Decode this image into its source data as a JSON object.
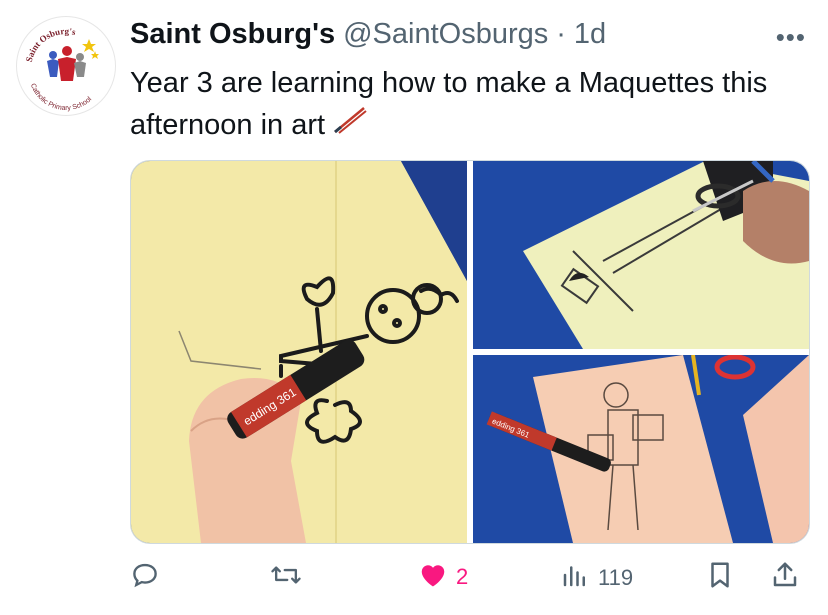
{
  "tweet": {
    "author_name": "Saint Osburg's",
    "handle": "@SaintOsburgs",
    "separator": "·",
    "time": "1d",
    "text": "Year 3 are learning how to make a Maquettes this afternoon in art",
    "emoji": "paintbrush-icon",
    "avatar": {
      "arc_top": "Saint Osburg's",
      "arc_bottom": "Catholic Primary School"
    },
    "photo1_marker_text": "edding 361",
    "photo3_marker_text": "edding 361"
  },
  "actions": {
    "reply_count": "",
    "retweet_count": "",
    "like_count": "2",
    "views_count": "119"
  },
  "colors": {
    "text": "#0f1419",
    "secondary": "#536471",
    "like": "#f91880",
    "border": "#cfd9de"
  }
}
